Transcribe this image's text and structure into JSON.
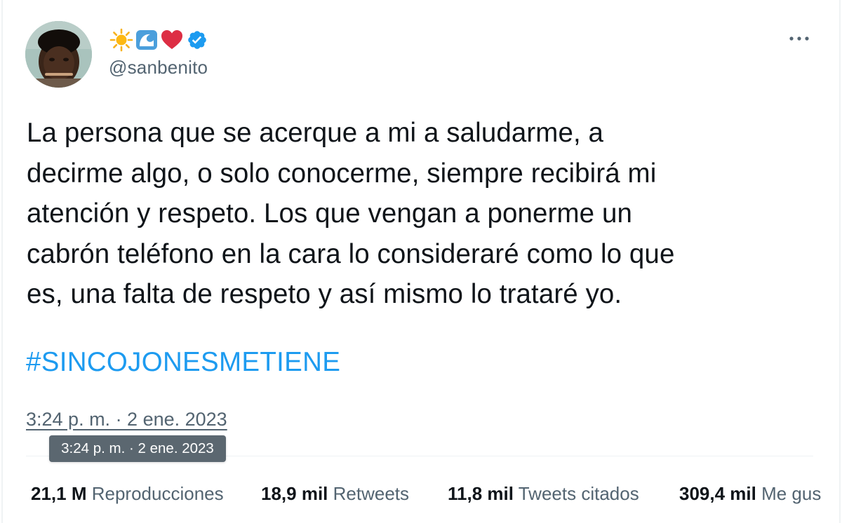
{
  "author": {
    "display_name_emojis": [
      "sun-emoji",
      "wave-emoji",
      "heart-emoji"
    ],
    "verified": true,
    "handle": "@sanbenito"
  },
  "tweet": {
    "text_lines": [
      "La persona que se acerque a mi a saludarme, a",
      "decirme algo, o solo conocerme, siempre recibirá mi",
      "atención y respeto. Los que vengan a ponerme un",
      "cabrón teléfono en la cara lo consideraré como lo que",
      "es, una falta de respeto y así mismo lo trataré yo."
    ],
    "hashtag": "#SINCOJONESMETIENE",
    "timestamp": "3:24 p. m. · 2 ene. 2023",
    "tooltip": "3:24 p. m. · 2 ene. 2023"
  },
  "stats": [
    {
      "value": "21,1 M",
      "label": "Reproducciones"
    },
    {
      "value": "18,9 mil",
      "label": "Retweets"
    },
    {
      "value": "11,8 mil",
      "label": "Tweets citados"
    },
    {
      "value": "309,4 mil",
      "label": "Me gus"
    }
  ],
  "colors": {
    "accent": "#1d9bf0",
    "text": "#0f1419",
    "secondary": "#536471",
    "tooltip_bg": "#5b6770"
  }
}
